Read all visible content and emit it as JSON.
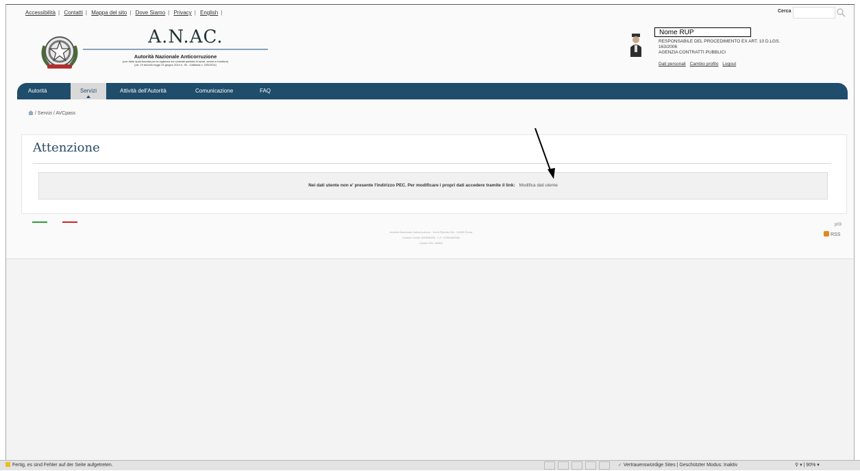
{
  "header": {
    "top_links": [
      "Accessibilità",
      "Contatti",
      "Mappa del sito",
      "Dove Siamo",
      "Privacy",
      "English"
    ],
    "search_label": "Cerca",
    "brand_title": "A.N.AC.",
    "brand_subtitle": "Autorità Nazionale Anticorruzione",
    "brand_small_1": "(con delle quali Autorità per la vigilanza sui contratti pubblici di lavori, servizi e forniture)",
    "brand_small_2": "(art. 19 decreto legge 24 giugno 2014 n. 90 - Gallitana n. 105/2014)"
  },
  "user": {
    "name": "Nome RUP",
    "role_line_1": "RESPONSABILE DEL PROCEDIMENTO EX ART. 10 D.LGS.",
    "role_line_2": "163/2006",
    "org": "AGENZIA CONTRATTI PUBBLICI",
    "links": [
      "Dati personali",
      "Cambio profilo",
      "Logout"
    ]
  },
  "nav": {
    "items": [
      "Autorità",
      "Servizi",
      "Attività dell'Autorità",
      "Comunicazione",
      "FAQ"
    ],
    "active": "Servizi"
  },
  "breadcrumb": {
    "items": [
      "Servizi",
      "AVCpass"
    ],
    "separator": "/"
  },
  "content": {
    "heading": "Attenzione",
    "message": "Nei dati utente non e' presente l'indirizzo PEC. Per modificare i propri dati accedere tramite il link:",
    "link_text": "Modifica dati utente"
  },
  "footer": {
    "line_1": "Autorità Nazionale Anticorruzione - Via di Ripetta 246 - 00186 Roma",
    "line_2": "Contact Center 800896936 - C.F. 97584460584",
    "line_3": "Codice IPA: UBIPA",
    "page_code": "p03",
    "rss_label": "RSS"
  },
  "statusbar": {
    "message": "Fertig, es sind Fehler auf der Seite aufgetreten.",
    "zone": "Vertrauenswürdige Sites | Geschützter Modus: Inaktiv",
    "zoom": "90%"
  },
  "colors": {
    "nav_bg": "#1f4d6b",
    "heading": "#2a4c66",
    "flag_green": "#2e9e3a",
    "flag_red": "#d02020"
  }
}
